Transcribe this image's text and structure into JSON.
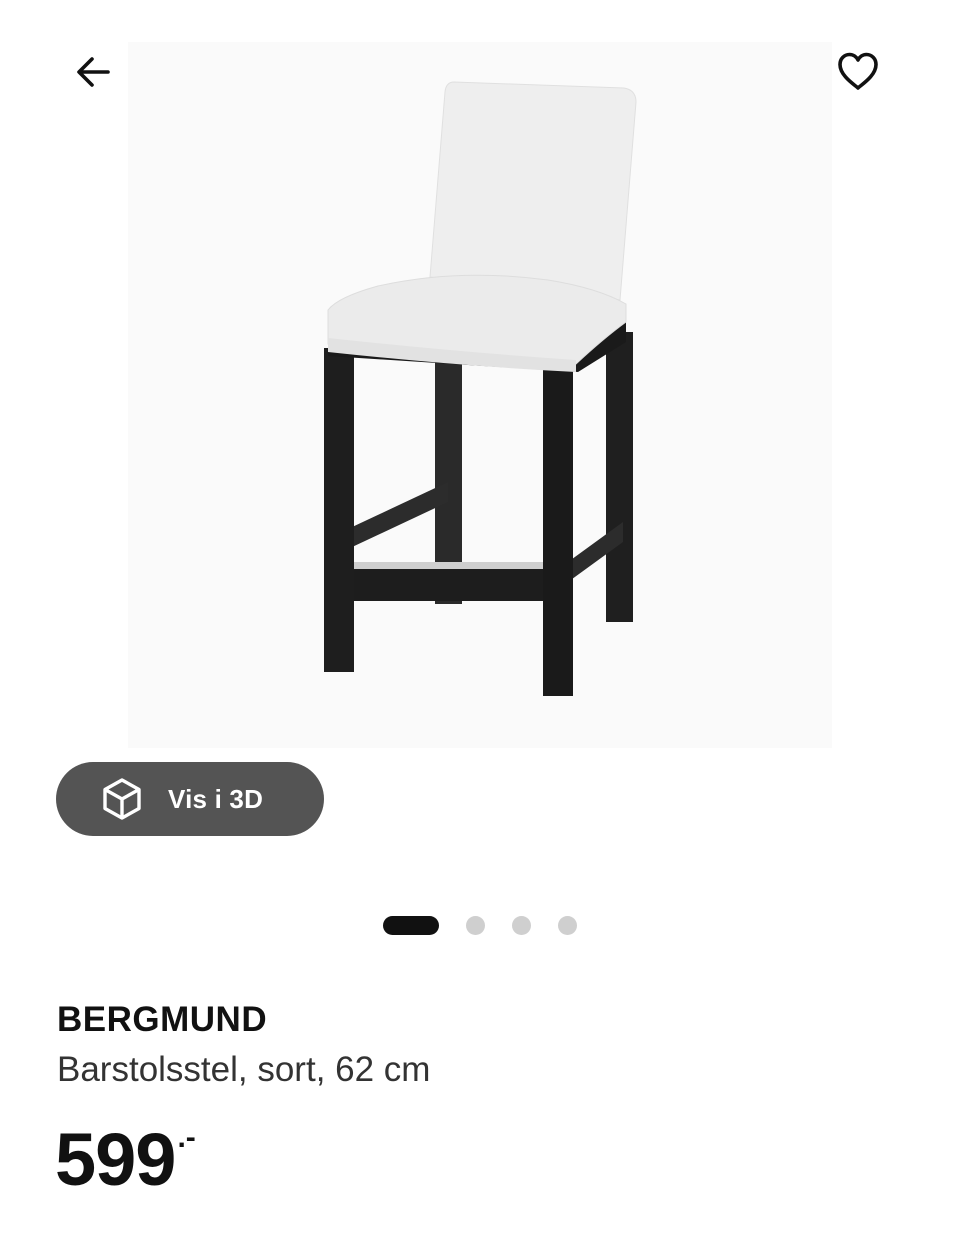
{
  "header": {
    "back_icon": "arrow-left-icon",
    "share_icon": "share-icon",
    "favorite_icon": "heart-outline-icon"
  },
  "gallery": {
    "image_alt": "product-photo-bar-stool",
    "view_3d_label": "Vis i 3D",
    "view_3d_icon": "cube-icon",
    "slide_count": 4,
    "active_slide": 1
  },
  "product": {
    "name": "BERGMUND",
    "description": "Barstolsstel, sort, 62 cm",
    "price_integer": "599",
    "price_suffix": ".-"
  },
  "colors": {
    "text_primary": "#111111",
    "button_3d_bg": "#545454",
    "dot_active": "#111111",
    "dot_inactive": "#cfcfcf",
    "chair_frame": "#232323",
    "chair_fabric": "#ececec"
  }
}
